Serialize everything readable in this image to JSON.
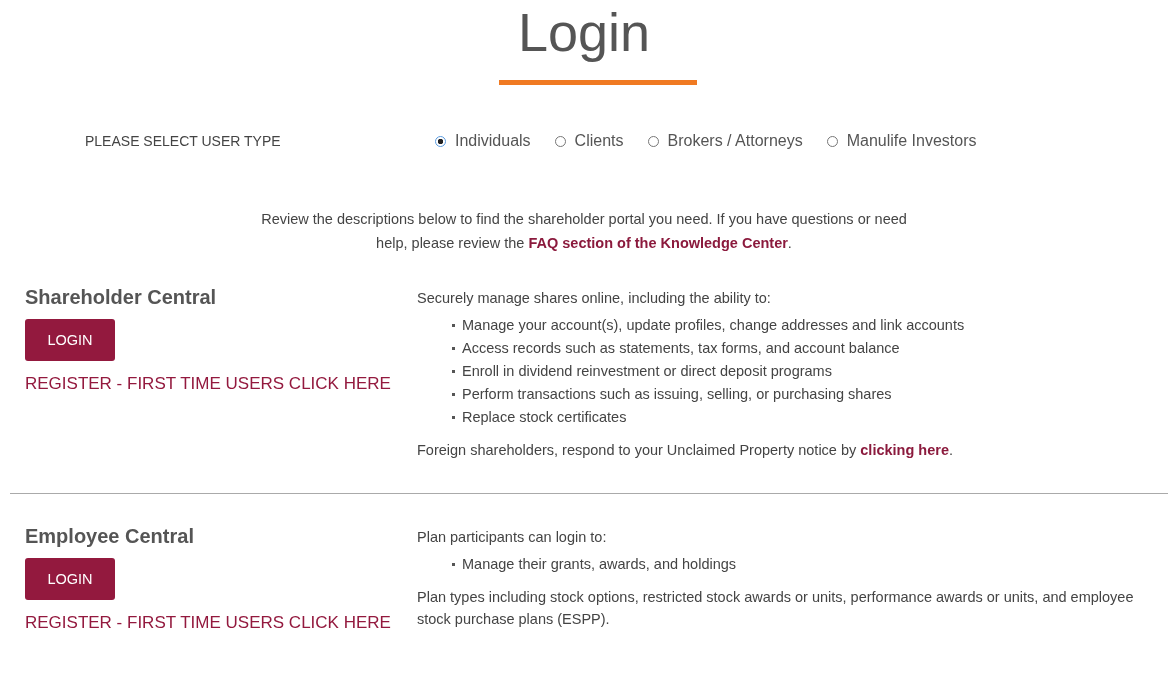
{
  "title": "Login",
  "user_type": {
    "label": "PLEASE SELECT USER TYPE",
    "options": [
      {
        "label": "Individuals",
        "selected": true
      },
      {
        "label": "Clients",
        "selected": false
      },
      {
        "label": "Brokers / Attorneys",
        "selected": false
      },
      {
        "label": "Manulife Investors",
        "selected": false
      }
    ]
  },
  "intro": {
    "before": "Review the descriptions below to find the shareholder portal you need. If you have questions or need help, please review the ",
    "link": "FAQ section of the Knowledge Center",
    "after": "."
  },
  "sections": [
    {
      "heading": "Shareholder Central",
      "login_button": "LOGIN",
      "register_link": "REGISTER - FIRST TIME USERS CLICK HERE",
      "lead": "Securely manage shares online, including the ability to:",
      "bullets": [
        "Manage your account(s), update profiles, change addresses and link accounts",
        "Access records such as statements, tax forms, and account balance",
        "Enroll in dividend reinvestment or direct deposit programs",
        "Perform transactions such as issuing, selling, or purchasing shares",
        "Replace stock certificates"
      ],
      "note": {
        "before": "Foreign shareholders, respond to your Unclaimed Property notice by ",
        "link": "clicking here",
        "after": "."
      }
    },
    {
      "heading": "Employee Central",
      "login_button": "LOGIN",
      "register_link": "REGISTER - FIRST TIME USERS CLICK HERE",
      "lead": "Plan participants can login to:",
      "bullets": [
        "Manage their grants, awards, and holdings"
      ],
      "note": {
        "before": "Plan types including stock options, restricted stock awards or units, performance awards or units, and employee stock purchase plans (ESPP)."
      }
    }
  ]
}
